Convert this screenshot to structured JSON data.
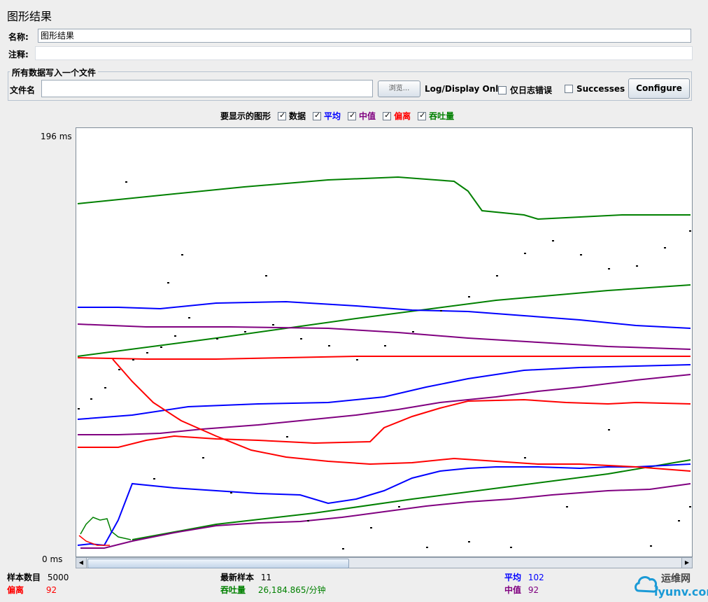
{
  "panel": {
    "title": "图形结果"
  },
  "name_row": {
    "label": "名称:",
    "value": "图形结果"
  },
  "comment_row": {
    "label": "注释:",
    "value": ""
  },
  "file_group": {
    "title": "所有数据写入一个文件",
    "file_label": "文件名",
    "file_value": "",
    "browse_label": "浏览...",
    "log_display_label": "Log/Display Only:",
    "errors_label": "仅日志错误",
    "successes_label": "Successes",
    "configure_label": "Configure"
  },
  "graph_toggles": {
    "label": "要显示的图形",
    "items": [
      {
        "label": "数据",
        "checked": true,
        "color": "#000000"
      },
      {
        "label": "平均",
        "checked": true,
        "color": "#0000ff"
      },
      {
        "label": "中值",
        "checked": true,
        "color": "#800080"
      },
      {
        "label": "偏离",
        "checked": true,
        "color": "#ff0000"
      },
      {
        "label": "吞吐量",
        "checked": true,
        "color": "#008000"
      }
    ]
  },
  "y_axis": {
    "max_label": "196  ms",
    "min_label": "0  ms"
  },
  "stats": {
    "samples_label": "样本数目",
    "samples_value": "5000",
    "deviation_label": "偏离",
    "deviation_value": "92",
    "latest_label": "最新样本",
    "latest_value": "11",
    "throughput_label": "吞吐量",
    "throughput_value": "26,184.865/分钟",
    "average_label": "平均",
    "average_value": "102",
    "median_label": "中值",
    "median_value": "92"
  },
  "watermark": {
    "text_top": "运维网",
    "text_bottom": "iyunv.com"
  },
  "chart_data": {
    "type": "line",
    "ylim": [
      0,
      196
    ],
    "y_unit": "ms",
    "series": [
      {
        "name": "吞吐量",
        "color": "#008000"
      },
      {
        "name": "平均",
        "color": "#0000ff"
      },
      {
        "name": "中值",
        "color": "#800080"
      },
      {
        "name": "偏离",
        "color": "#ff0000"
      },
      {
        "name": "数据",
        "color": "#000000"
      }
    ]
  }
}
